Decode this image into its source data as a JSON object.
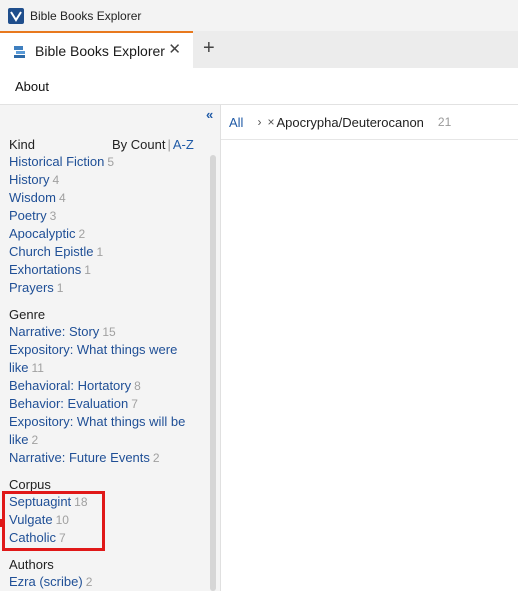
{
  "window": {
    "title": "Bible Books Explorer",
    "app_icon": "logos-icon"
  },
  "tabs": [
    {
      "label": "Bible Books Explorer",
      "close": "✕",
      "active": true
    }
  ],
  "new_tab": "+",
  "menu": {
    "about": "About"
  },
  "sidebar": {
    "collapse": "«",
    "sort": {
      "by_count": "By Count",
      "separator": "|",
      "az": "A-Z"
    },
    "sections": {
      "kind": {
        "title": "Kind",
        "items": [
          {
            "label": "Historical Fiction",
            "count": "5"
          },
          {
            "label": "History",
            "count": "4"
          },
          {
            "label": "Wisdom",
            "count": "4"
          },
          {
            "label": "Poetry",
            "count": "3"
          },
          {
            "label": "Apocalyptic",
            "count": "2"
          },
          {
            "label": "Church Epistle",
            "count": "1"
          },
          {
            "label": "Exhortations",
            "count": "1"
          },
          {
            "label": "Prayers",
            "count": "1"
          }
        ]
      },
      "genre": {
        "title": "Genre",
        "items": [
          {
            "label": "Narrative: Story",
            "count": "15"
          },
          {
            "label_line1": "Expository: What things were",
            "label_line2": "like",
            "count": "11"
          },
          {
            "label": "Behavioral: Hortatory",
            "count": "8"
          },
          {
            "label": "Behavior: Evaluation",
            "count": "7"
          },
          {
            "label_line1": "Expository: What things will be",
            "label_line2": "like",
            "count": "2"
          },
          {
            "label": "Narrative: Future Events",
            "count": "2"
          }
        ]
      },
      "corpus": {
        "title": "Corpus",
        "items": [
          {
            "label": "Septuagint",
            "count": "18"
          },
          {
            "label": "Vulgate",
            "count": "10"
          },
          {
            "label": "Catholic",
            "count": "7"
          }
        ]
      },
      "authors": {
        "title": "Authors",
        "items": [
          {
            "label": "Ezra (scribe)",
            "count": "2"
          }
        ]
      }
    }
  },
  "breadcrumb": {
    "all": "All",
    "separator": "›",
    "remove": "×",
    "filter": "Apocrypha/Deuterocanon",
    "count": "21"
  },
  "colors": {
    "accent": "#e8791e",
    "link": "#1f4f96",
    "highlight": "#e01818"
  }
}
